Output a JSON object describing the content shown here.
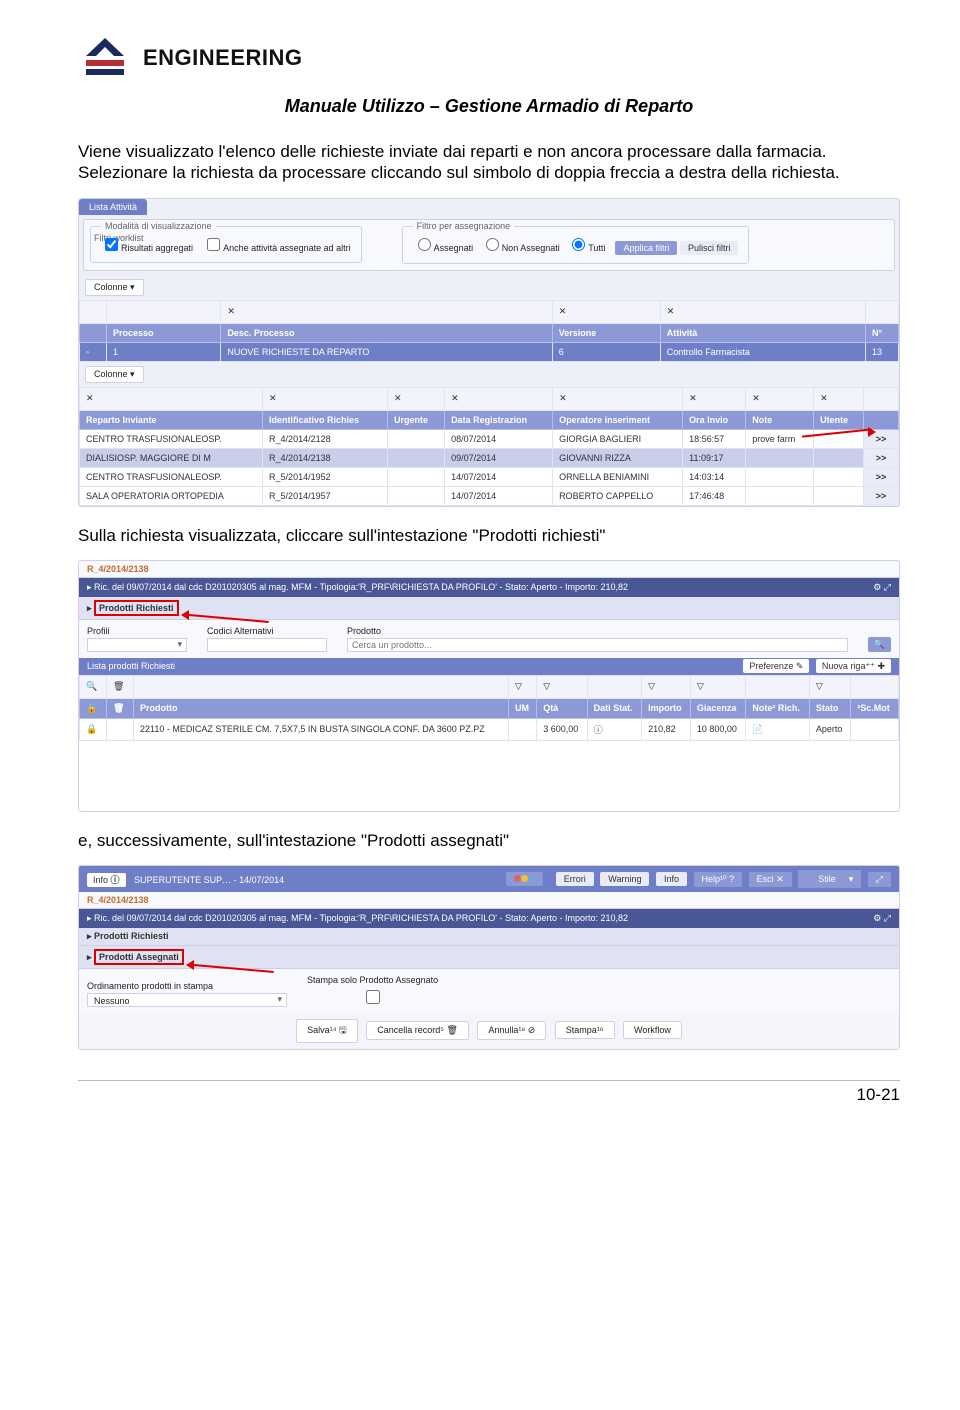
{
  "brand": "ENGINEERING",
  "doc_title": "Manuale Utilizzo – Gestione Armadio di Reparto",
  "p1": "Viene visualizzato l'elenco delle richieste inviate dai reparti e non ancora processare dalla farmacia.",
  "p2": "Selezionare la richiesta da processare cliccando sul simbolo di doppia freccia a destra della richiesta.",
  "p3": "Sulla richiesta visualizzata, cliccare sull'intestazione \"Prodotti richiesti\"",
  "p4": "e, successivamente, sull'intestazione \"Prodotti assegnati\"",
  "s1": {
    "tab": "Lista Attività",
    "filters_title": "Filtri worklist",
    "mode_title": "Modalità di visualizzazione",
    "mode_aggregati": "Risultati aggregati",
    "mode_altre": "Anche attività assegnate ad altri",
    "assign_title": "Filtro per assegnazione",
    "assign_assegnati": "Assegnati",
    "assign_non": "Non Assegnati",
    "assign_tutti": "Tutti",
    "apply": "Applica filtri",
    "clear": "Pulisci filtri",
    "colonne": "Colonne ▾",
    "h": {
      "processo": "Processo",
      "desc": "Desc. Processo",
      "versione": "Versione",
      "attivita": "Attività",
      "n": "N°"
    },
    "r1": {
      "processo": "1",
      "desc": "NUOVE RICHIESTE DA REPARTO",
      "versione": "6",
      "attivita": "Controllo Farmacista",
      "n": "13"
    },
    "h2": {
      "reparto": "Reparto Inviante",
      "id": "Identificativo Richies",
      "urg": "Urgente",
      "data": "Data Registrazion",
      "op": "Operatore inseriment",
      "ora": "Ora Invio",
      "note": "Note",
      "utente": "Utente"
    },
    "rows": [
      {
        "reparto": "CENTRO TRASFUSIONALEOSP.",
        "id": "R_4/2014/2128",
        "data": "08/07/2014",
        "op": "GIORGIA BAGLIERI",
        "ora": "18:56:57",
        "note": "prove farm"
      },
      {
        "reparto": "DIALISIOSP. MAGGIORE DI M",
        "id": "R_4/2014/2138",
        "data": "09/07/2014",
        "op": "GIOVANNI RIZZA",
        "ora": "11:09:17",
        "note": ""
      },
      {
        "reparto": "CENTRO TRASFUSIONALEOSP.",
        "id": "R_5/2014/1952",
        "data": "14/07/2014",
        "op": "ORNELLA BENIAMINI",
        "ora": "14:03:14",
        "note": ""
      },
      {
        "reparto": "SALA OPERATORIA ORTOPEDIA",
        "id": "R_5/2014/1957",
        "data": "14/07/2014",
        "op": "ROBERTO CAPPELLO",
        "ora": "17:46:48",
        "note": ""
      }
    ],
    "arrow": ">>"
  },
  "s2": {
    "crumb": "R_4/2014/2138",
    "headline": "▸ Ric. del 09/07/2014 dal cdc D201020305 al mag. MFM - Tipologia:'R_PRF\\RICHIESTA DA PROFILO' - Stato: Aperto - Importo: 210,82",
    "tab1": "Prodotti Richiesti",
    "f_profili": "Profili",
    "f_codici": "Codici Alternativi",
    "f_prodotto": "Prodotto",
    "ph_prodotto": "Cerca un prodotto...",
    "listtitle": "Lista prodotti Richiesti",
    "pref": "Preferenze ✎",
    "nuova": "Nuova riga⁺⁺ ✚",
    "h": {
      "prodotto": "Prodotto",
      "um": "UM",
      "qta": "Qtà",
      "dati": "Dati Stat.",
      "importo": "Importo",
      "giacenza": "Giacenza",
      "noterich": "Note² Rich.",
      "stato": "Stato",
      "scmot": "²Sc.Mot"
    },
    "row": {
      "prodotto": "22110 - MEDICAZ STERILE CM. 7,5X7,5 IN BUSTA SINGOLA CONF. DA 3600 PZ.PZ",
      "qta": "3 600,00",
      "importo": "210,82",
      "giacenza": "10 800,00",
      "stato": "Aperto"
    }
  },
  "s3": {
    "info": "Info",
    "user": "SUPERUTENTE SUP… - 14/07/2014",
    "errori": "Errori",
    "warning": "Warning",
    "infolbl": "Info",
    "help": "Help¹⁰ ?",
    "esci": "Esci ✕",
    "stile": "Stile",
    "crumb": "R_4/2014/2138",
    "headline": "▸ Ric. del 09/07/2014 dal cdc D201020305 al mag. MFM - Tipologia:'R_PRF\\RICHIESTA DA PROFILO' - Stato: Aperto - Importo: 210,82",
    "tab1": "▸ Prodotti Richiesti",
    "tab2": "Prodotti Assegnati",
    "ord_label": "Ordinamento prodotti in stampa",
    "ord_val": "Nessuno",
    "stampa_solo": "Stampa solo Prodotto Assegnato",
    "btn_salva": "Salva¹⁴ 🖫",
    "btn_canc": "Cancella record⁵ 🗑",
    "btn_ann": "Annulla¹⁸ ⊘",
    "btn_stampa": "Stampa¹⁶",
    "btn_wf": "Workflow"
  },
  "pagenum": "10-21"
}
